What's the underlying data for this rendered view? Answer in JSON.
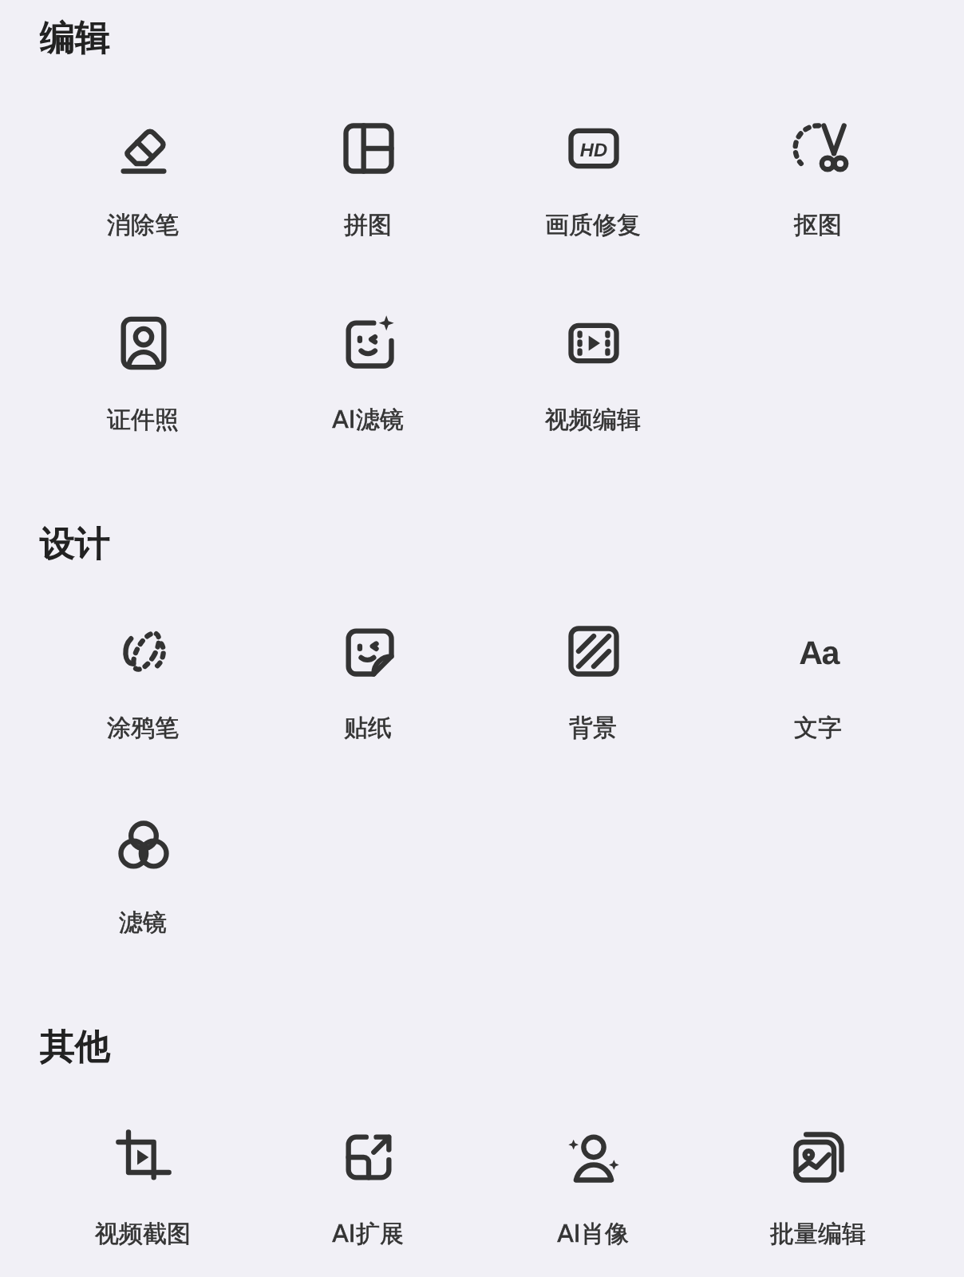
{
  "sections": [
    {
      "title": "编辑",
      "items": [
        {
          "label": "消除笔",
          "kind": "eraser"
        },
        {
          "label": "拼图",
          "kind": "collage"
        },
        {
          "label": "画质修复",
          "kind": "hd",
          "icon_text": "HD"
        },
        {
          "label": "抠图",
          "kind": "cutout"
        },
        {
          "label": "证件照",
          "kind": "idphoto"
        },
        {
          "label": "AI滤镜",
          "kind": "aifilter"
        },
        {
          "label": "视频编辑",
          "kind": "video"
        }
      ]
    },
    {
      "title": "设计",
      "items": [
        {
          "label": "涂鸦笔",
          "kind": "doodle"
        },
        {
          "label": "贴纸",
          "kind": "sticker"
        },
        {
          "label": "背景",
          "kind": "background"
        },
        {
          "label": "文字",
          "kind": "text",
          "icon_text": "Aa"
        },
        {
          "label": "滤镜",
          "kind": "filter"
        }
      ]
    },
    {
      "title": "其他",
      "items": [
        {
          "label": "视频截图",
          "kind": "crop"
        },
        {
          "label": "AI扩展",
          "kind": "expand"
        },
        {
          "label": "AI肖像",
          "kind": "portrait"
        },
        {
          "label": "批量编辑",
          "kind": "batch"
        }
      ]
    }
  ]
}
